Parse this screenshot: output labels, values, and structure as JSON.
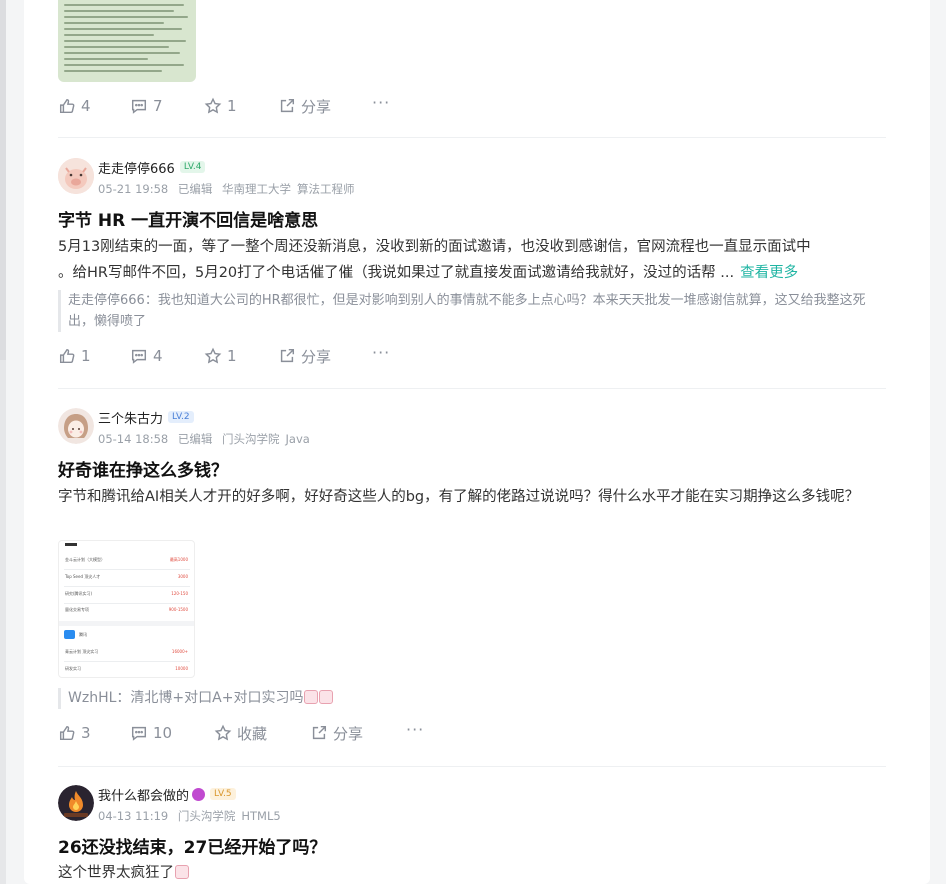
{
  "posts": [
    {
      "actions": {
        "like": "4",
        "comment": "7",
        "star": "1",
        "share": "分享"
      }
    },
    {
      "author": "走走停停666",
      "level": "LV.4",
      "date": "05-21 19:58",
      "edited": "已编辑",
      "school": "华南理工大学",
      "job": "算法工程师",
      "title": "字节 HR 一直开演不回信是啥意思",
      "body_line1": "5月13刚结束的一面，等了一整个周还没新消息，没收到新的面试邀请，也没收到感谢信，官网流程也一直显示面试中",
      "body_line2": "。给HR写邮件不回，5月20打了个电话催了催（我说如果过了就直接发面试邀请给我就好，没过的话帮 ...",
      "more": "查看更多",
      "comment_author": "走走停停666：",
      "comment_text": "我也知道大公司的HR都很忙，但是对影响到别人的事情就不能多上点心吗？本来天天批发一堆感谢信就算，这又给我整这死出，懒得喷了",
      "actions": {
        "like": "1",
        "comment": "4",
        "star": "1",
        "share": "分享"
      }
    },
    {
      "author": "三个朱古力",
      "level": "LV.2",
      "date": "05-14 18:58",
      "edited": "已编辑",
      "school": "门头沟学院",
      "job": "Java",
      "title": "好奇谁在挣这么多钱？",
      "body": "字节和腾讯给AI相关人才开的好多啊，好好奇这些人的bg，有了解的佬路过说说吗？得什么水平才能在实习期挣这么多钱呢？",
      "comment_author": "WzhHL：",
      "comment_text": "清北博+对口A+对口实习吗",
      "actions": {
        "like": "3",
        "comment": "10",
        "star": "收藏",
        "share": "分享"
      }
    },
    {
      "author": "我什么都会做的",
      "level": "LV.5",
      "date": "04-13 11:19",
      "school": "门头沟学院",
      "job": "HTML5",
      "title": "26还没找结束，27已经开始了吗？",
      "body": "这个世界太疯狂了"
    }
  ],
  "thumbnail": {
    "rows": [
      {
        "name": "金斗云计划（大模型）",
        "pay": "最高1000"
      },
      {
        "name": "Top Seed 顶尖人才",
        "pay": "3000"
      },
      {
        "name": "研究(腾讯实习)",
        "pay": "120-150"
      },
      {
        "name": "量化交易专项",
        "pay": "900-1500"
      },
      {
        "name": "腾讯",
        "pay": ""
      },
      {
        "name": "青云计划 顶尖实习",
        "pay": "16000+"
      },
      {
        "name": "研发实习",
        "pay": "10000"
      }
    ]
  },
  "colors": {
    "accent": "#20b5a3",
    "lv4_bg": "#e3f6ea",
    "lv4_fg": "#2fa86a",
    "lv2_bg": "#e4eefc",
    "lv2_fg": "#4a7fd6",
    "lv5_bg": "#fdf1dc",
    "lv5_fg": "#d9962c"
  }
}
